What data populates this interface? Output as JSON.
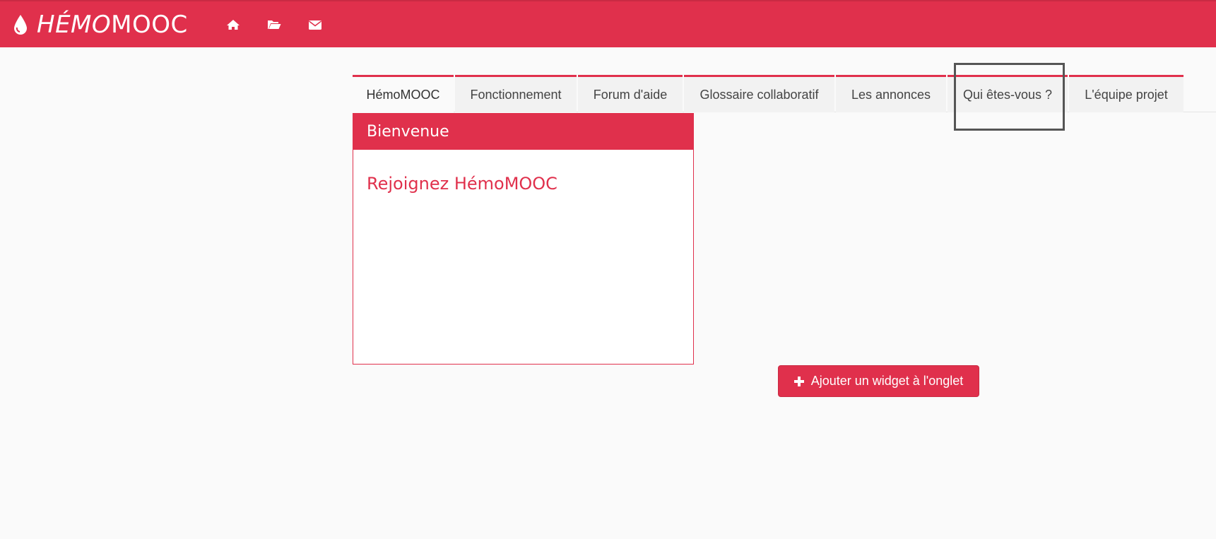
{
  "header": {
    "brand_main": "HÉMO",
    "brand_rest": "MOOC",
    "icons": [
      "drop-icon",
      "home-icon",
      "folder-open-icon",
      "envelope-icon"
    ]
  },
  "tabs": [
    {
      "label": "HémoMOOC",
      "active": true
    },
    {
      "label": "Fonctionnement",
      "active": false
    },
    {
      "label": "Forum d'aide",
      "active": false
    },
    {
      "label": "Glossaire collaboratif",
      "active": false
    },
    {
      "label": "Les annonces",
      "active": false
    },
    {
      "label": "Qui êtes-vous ?",
      "active": false
    },
    {
      "label": "L'équipe projet",
      "active": false
    }
  ],
  "widget": {
    "title": "Bienvenue",
    "link": "Rejoignez HémoMOOC"
  },
  "add_widget": {
    "label": "Ajouter un widget à l'onglet"
  },
  "colors": {
    "brand": "#e0304c",
    "background": "#fafafa",
    "highlight": "#555555"
  }
}
